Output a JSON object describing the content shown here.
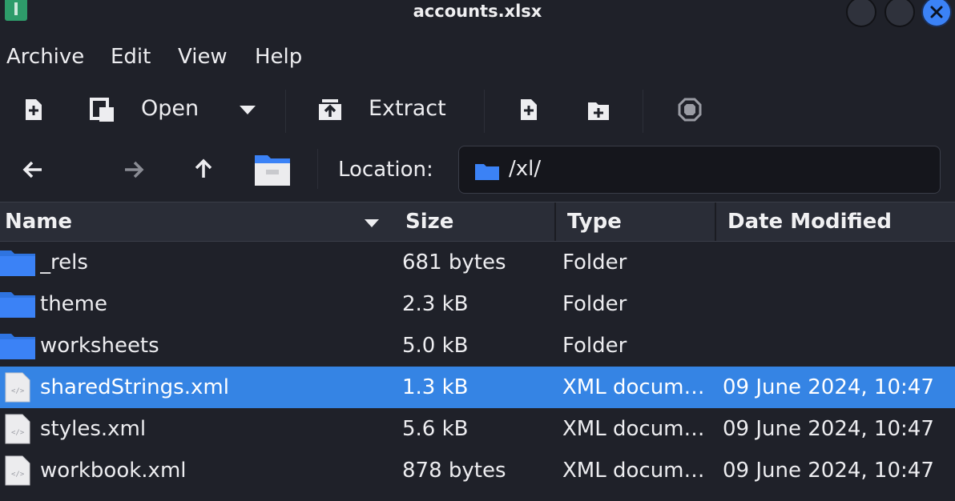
{
  "window": {
    "title": "accounts.xlsx"
  },
  "menu": [
    "Archive",
    "Edit",
    "View",
    "Help"
  ],
  "toolbar": {
    "open_label": "Open",
    "extract_label": "Extract"
  },
  "location": {
    "label": "Location:",
    "path": "/xl/"
  },
  "table": {
    "columns": {
      "name": "Name",
      "size": "Size",
      "type": "Type",
      "date": "Date Modified"
    },
    "rows": [
      {
        "name": "_rels",
        "size": "681 bytes",
        "type": "Folder",
        "date": "",
        "kind": "folder"
      },
      {
        "name": "theme",
        "size": "2.3 kB",
        "type": "Folder",
        "date": "",
        "kind": "folder"
      },
      {
        "name": "worksheets",
        "size": "5.0 kB",
        "type": "Folder",
        "date": "",
        "kind": "folder"
      },
      {
        "name": "sharedStrings.xml",
        "size": "1.3 kB",
        "type": "XML docum…",
        "date": "09 June 2024, 10:47",
        "kind": "xml",
        "selected": true
      },
      {
        "name": "styles.xml",
        "size": "5.6 kB",
        "type": "XML docum…",
        "date": "09 June 2024, 10:47",
        "kind": "xml"
      },
      {
        "name": "workbook.xml",
        "size": "878 bytes",
        "type": "XML docum…",
        "date": "09 June 2024, 10:47",
        "kind": "xml"
      }
    ]
  },
  "colors": {
    "accent": "#3584e4",
    "folder": "#3b82f6",
    "background": "#1f2129"
  }
}
